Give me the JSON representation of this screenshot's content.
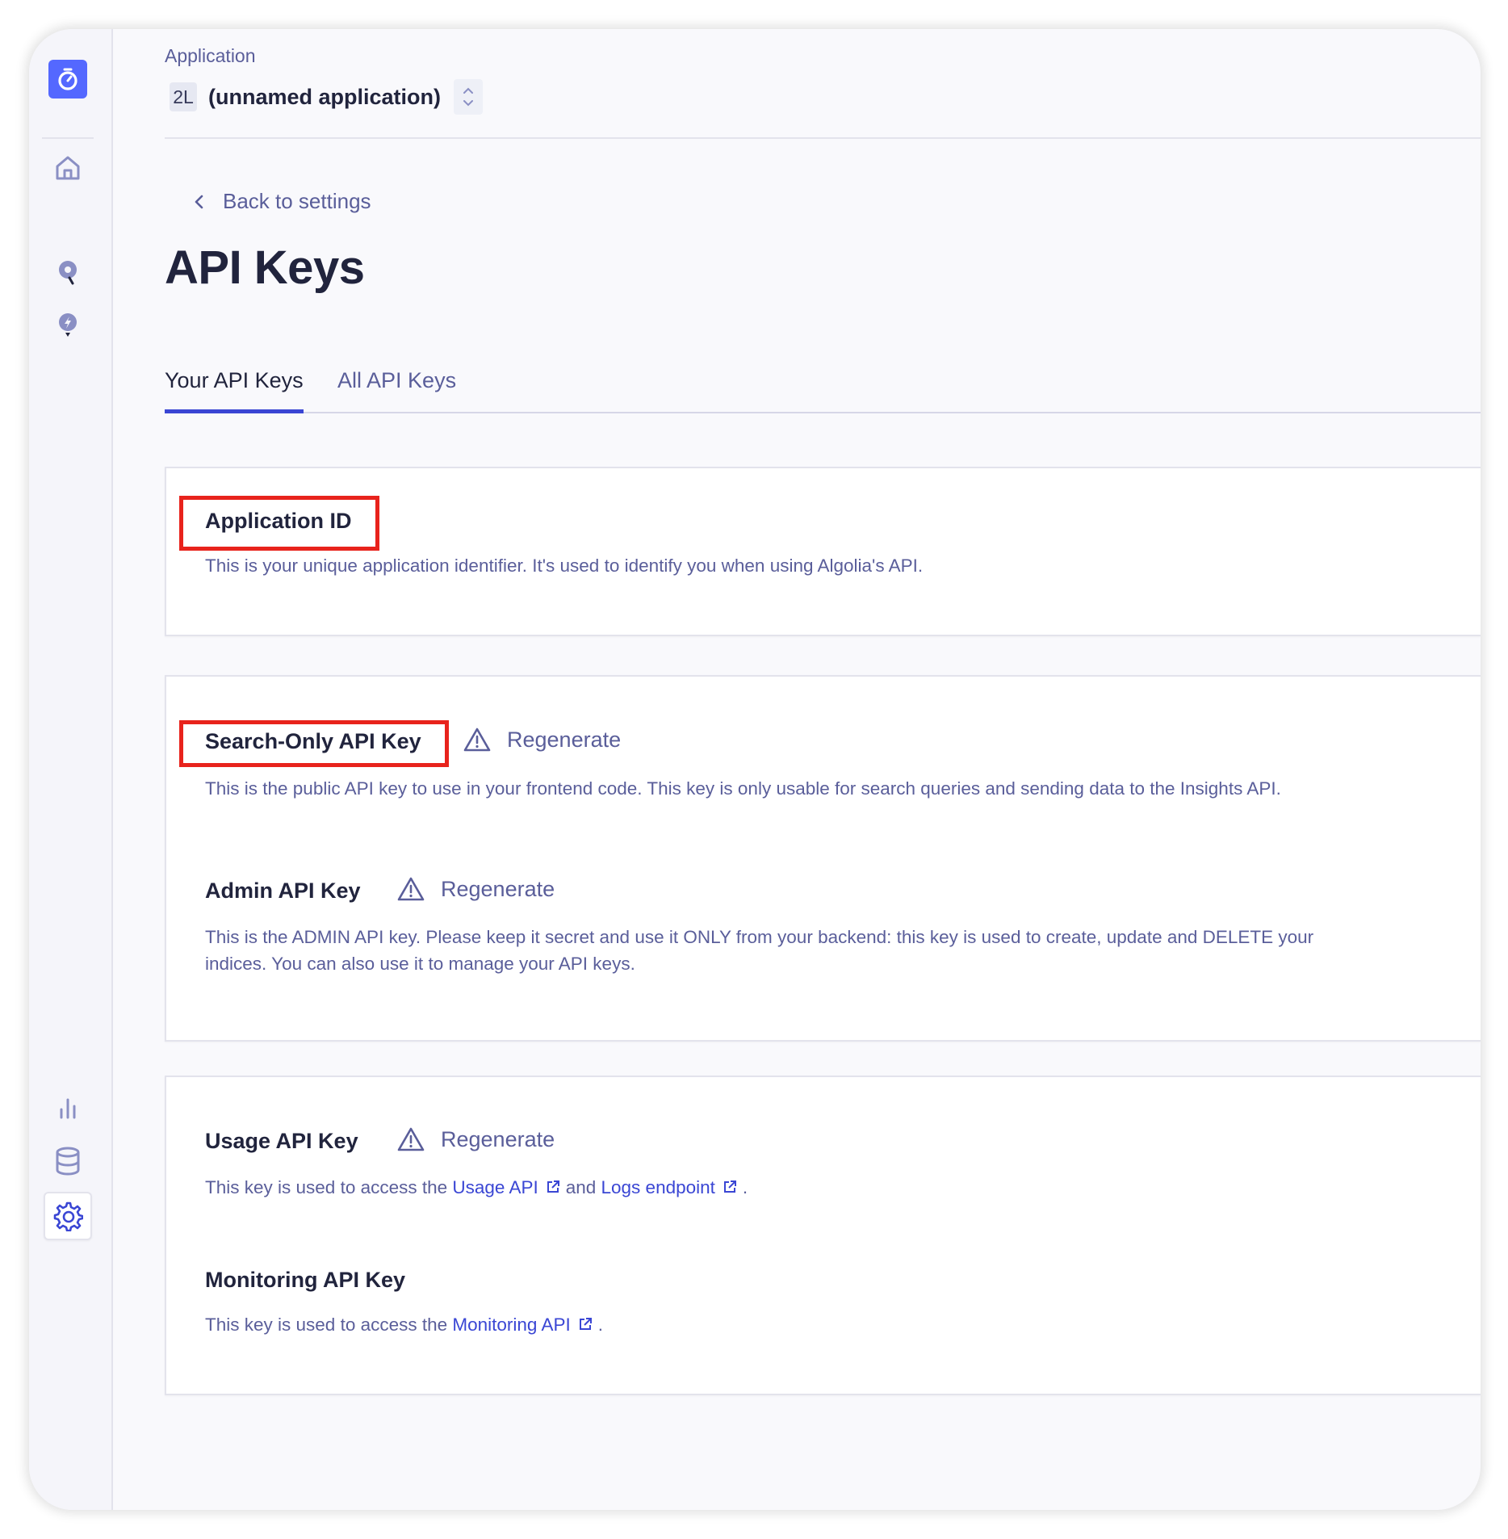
{
  "app": {
    "label": "Application",
    "badge": "2L",
    "name": "(unnamed application)"
  },
  "nav": {
    "back_label": "Back to settings"
  },
  "page": {
    "title": "API Keys"
  },
  "tabs": [
    {
      "label": "Your API Keys",
      "active": true
    },
    {
      "label": "All API Keys",
      "active": false
    }
  ],
  "sidebar": {
    "icons": [
      "algolia-logo-icon",
      "home-icon",
      "search-pin-icon",
      "bolt-pin-icon",
      "analytics-icon",
      "database-icon",
      "settings-icon"
    ]
  },
  "cards": {
    "application_id": {
      "title": "Application ID",
      "description": "This is your unique application identifier. It's used to identify you when using Algolia's API."
    },
    "search_only": {
      "title": "Search-Only API Key",
      "regenerate": "Regenerate",
      "description": "This is the public API key to use in your frontend code. This key is only usable for search queries and sending data to the Insights API."
    },
    "admin": {
      "title": "Admin API Key",
      "regenerate": "Regenerate",
      "description_line1": "This is the ADMIN API key. Please keep it secret and use it ONLY from your backend: this key is used to create, update and DELETE your",
      "description_line2": "indices. You can also use it to manage your API keys."
    },
    "usage": {
      "title": "Usage API Key",
      "regenerate": "Regenerate",
      "desc_prefix": "This key is used to access the ",
      "link1": "Usage API",
      "desc_mid": "and ",
      "link2": "Logs endpoint",
      "desc_suffix": "."
    },
    "monitoring": {
      "title": "Monitoring API Key",
      "desc_prefix": "This key is used to access the ",
      "link": "Monitoring API",
      "desc_suffix": "."
    }
  },
  "colors": {
    "accent": "#3a46d4",
    "brand": "#5468ff",
    "highlight": "#e8231c",
    "text_primary": "#21243d",
    "text_secondary": "#5a5e9a"
  }
}
